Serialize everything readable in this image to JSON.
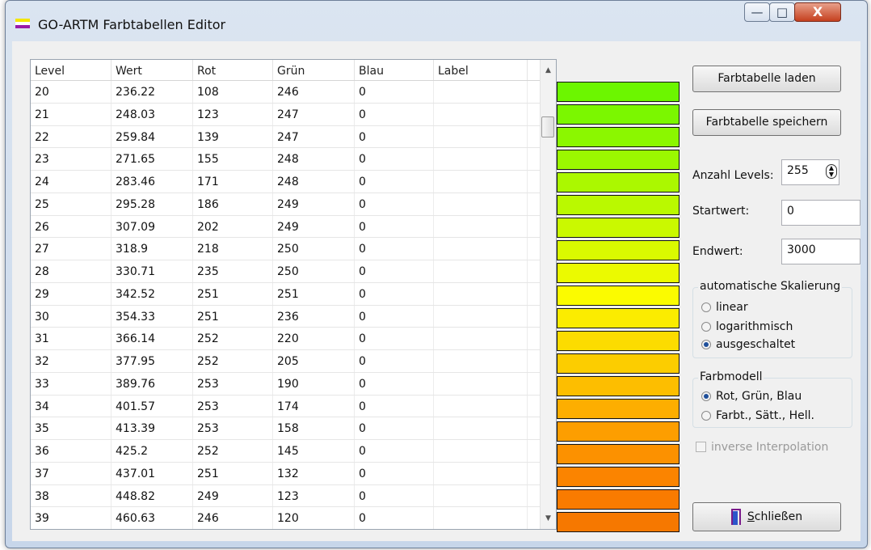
{
  "window": {
    "title": "GO-ARTM Farbtabellen Editor",
    "controls": {
      "minimize": "—",
      "maximize": "□",
      "close": "X"
    }
  },
  "table": {
    "columns": [
      "Level",
      "Wert",
      "Rot",
      "Grün",
      "Blau",
      "Label"
    ],
    "rows": [
      [
        "20",
        "236.22",
        "108",
        "246",
        "0",
        ""
      ],
      [
        "21",
        "248.03",
        "123",
        "247",
        "0",
        ""
      ],
      [
        "22",
        "259.84",
        "139",
        "247",
        "0",
        ""
      ],
      [
        "23",
        "271.65",
        "155",
        "248",
        "0",
        ""
      ],
      [
        "24",
        "283.46",
        "171",
        "248",
        "0",
        ""
      ],
      [
        "25",
        "295.28",
        "186",
        "249",
        "0",
        ""
      ],
      [
        "26",
        "307.09",
        "202",
        "249",
        "0",
        ""
      ],
      [
        "27",
        "318.9",
        "218",
        "250",
        "0",
        ""
      ],
      [
        "28",
        "330.71",
        "235",
        "250",
        "0",
        ""
      ],
      [
        "29",
        "342.52",
        "251",
        "251",
        "0",
        ""
      ],
      [
        "30",
        "354.33",
        "251",
        "236",
        "0",
        ""
      ],
      [
        "31",
        "366.14",
        "252",
        "220",
        "0",
        ""
      ],
      [
        "32",
        "377.95",
        "252",
        "205",
        "0",
        ""
      ],
      [
        "33",
        "389.76",
        "253",
        "190",
        "0",
        ""
      ],
      [
        "34",
        "401.57",
        "253",
        "174",
        "0",
        ""
      ],
      [
        "35",
        "413.39",
        "253",
        "158",
        "0",
        ""
      ],
      [
        "36",
        "425.2",
        "252",
        "145",
        "0",
        ""
      ],
      [
        "37",
        "437.01",
        "251",
        "132",
        "0",
        ""
      ],
      [
        "38",
        "448.82",
        "249",
        "123",
        "0",
        ""
      ],
      [
        "39",
        "460.63",
        "246",
        "120",
        "0",
        ""
      ]
    ]
  },
  "buttons": {
    "load": "Farbtabelle laden",
    "save": "Farbtabelle speichern",
    "close_accel": "S",
    "close_rest": "chließen"
  },
  "fields": {
    "levels_label": "Anzahl Levels:",
    "levels_value": "255",
    "start_label": "Startwert:",
    "start_value": "0",
    "end_label": "Endwert:",
    "end_value": "3000"
  },
  "scaling": {
    "title": "automatische Skalierung",
    "options": [
      "linear",
      "logarithmisch",
      "ausgeschaltet"
    ],
    "selected": 2
  },
  "color_model": {
    "title": "Farbmodell",
    "options": [
      "Rot, Grün, Blau",
      "Farbt., Sätt., Hell."
    ],
    "selected": 0
  },
  "inverse": {
    "label": "inverse Interpolation",
    "checked": false,
    "enabled": false
  }
}
